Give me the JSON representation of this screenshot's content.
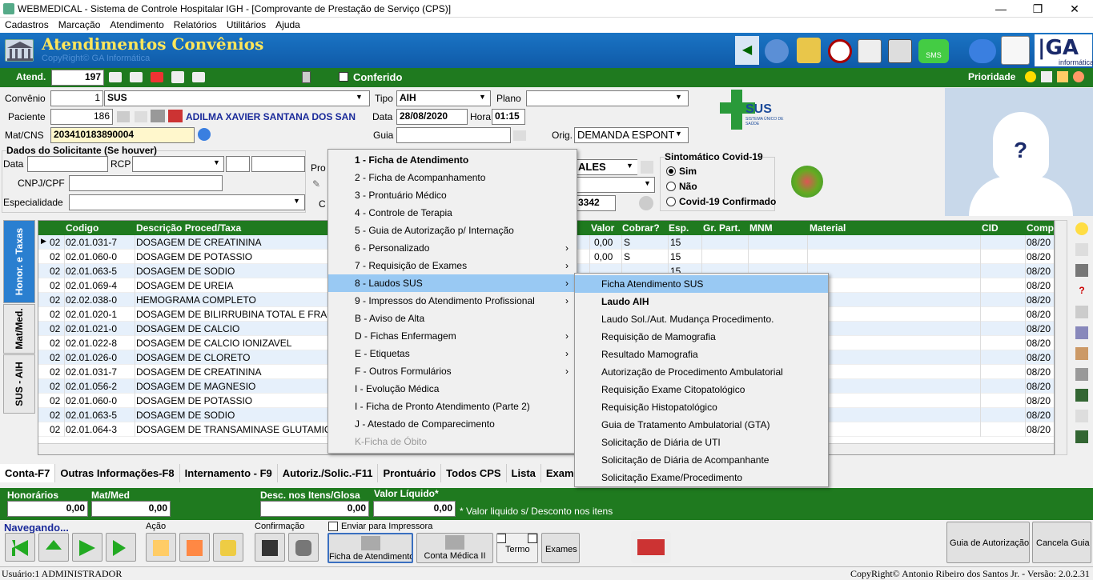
{
  "window": {
    "title": "WEBMEDICAL - Sistema de Controle Hospitalar IGH - [Comprovante de Prestação de Serviço  (CPS)]",
    "minimize": "—",
    "restore": "❐",
    "close": "✕"
  },
  "menubar": [
    "Cadastros",
    "Marcação",
    "Atendimento",
    "Relatórios",
    "Utilitários",
    "Ajuda"
  ],
  "banner": {
    "title": "Atendimentos Convênios",
    "subtitle": "CopyRight© GA Informática",
    "brand": "informática"
  },
  "topbar": {
    "atend_label": "Atend.",
    "atend_value": "197",
    "conferido": "Conferido",
    "prioridade": "Prioridade"
  },
  "form": {
    "convenio_label": "Convênio",
    "convenio_code": "1",
    "convenio_name": "SUS",
    "tipo_label": "Tipo",
    "tipo_value": "AIH",
    "plano_label": "Plano",
    "plano_value": "",
    "paciente_label": "Paciente",
    "paciente_code": "186",
    "paciente_name": "ADILMA XAVIER SANTANA DOS SAN",
    "data_label": "Data",
    "data_value": "28/08/2020",
    "hora_label": "Hora",
    "hora_value": "01:15",
    "matcns_label": "Mat/CNS",
    "matcns_value": "203410183890004",
    "guia_label": "Guia",
    "guia_value": "",
    "orig_label": "Orig.",
    "orig_value": "DEMANDA ESPONT",
    "solicitante_header": "Dados do Solicitante (Se houver)",
    "data2_label": "Data",
    "rcp_label": "RCP",
    "cnpj_label": "CNPJ/CPF",
    "especialidade_label": "Especialidade",
    "pro_label": "Pro",
    "c_label": "C",
    "partial1": "ALES",
    "partial2": "3342"
  },
  "covid": {
    "title": "Sintomático Covid-19",
    "options": [
      "Sim",
      "Não",
      "Covid-19 Confirmado"
    ],
    "selected": "Sim"
  },
  "sus_logo": {
    "text": "SUS",
    "sub": "SISTEMA ÚNICO DE SAÚDE"
  },
  "vtabs": [
    "Honor. e Taxas",
    "Mat/Med.",
    "SUS - AIH"
  ],
  "grid": {
    "headers": {
      "codigo": "Codigo",
      "descricao": "Descrição Proced/Taxa",
      "valor": "Valor",
      "cobrar": "Cobrar?",
      "esp": "Esp.",
      "grpart": "Gr. Part.",
      "mnm": "MNM",
      "material": "Material",
      "cid": "CID",
      "comp": "Comp"
    },
    "rows": [
      {
        "g": "02",
        "cod": "02.01.031-7",
        "desc": "DOSAGEM DE CREATININA",
        "valor": "0,00",
        "cob": "S",
        "esp": "15",
        "comp": "08/20"
      },
      {
        "g": "02",
        "cod": "02.01.060-0",
        "desc": "DOSAGEM DE POTASSIO",
        "valor": "0,00",
        "cob": "S",
        "esp": "15",
        "comp": "08/20"
      },
      {
        "g": "02",
        "cod": "02.01.063-5",
        "desc": "DOSAGEM DE SODIO",
        "valor": "",
        "cob": "",
        "esp": "15",
        "comp": "08/20"
      },
      {
        "g": "02",
        "cod": "02.01.069-4",
        "desc": "DOSAGEM DE UREIA",
        "valor": "",
        "cob": "",
        "esp": "",
        "comp": "08/20"
      },
      {
        "g": "02",
        "cod": "02.02.038-0",
        "desc": "HEMOGRAMA COMPLETO",
        "valor": "",
        "cob": "",
        "esp": "",
        "comp": "08/20"
      },
      {
        "g": "02",
        "cod": "02.01.020-1",
        "desc": "DOSAGEM DE BILIRRUBINA TOTAL E FRAC",
        "valor": "",
        "cob": "",
        "esp": "",
        "comp": "08/20"
      },
      {
        "g": "02",
        "cod": "02.01.021-0",
        "desc": "DOSAGEM DE CALCIO",
        "valor": "",
        "cob": "",
        "esp": "",
        "comp": "08/20"
      },
      {
        "g": "02",
        "cod": "02.01.022-8",
        "desc": "DOSAGEM DE CALCIO IONIZAVEL",
        "valor": "",
        "cob": "",
        "esp": "",
        "comp": "08/20"
      },
      {
        "g": "02",
        "cod": "02.01.026-0",
        "desc": "DOSAGEM DE CLORETO",
        "valor": "",
        "cob": "",
        "esp": "",
        "comp": "08/20"
      },
      {
        "g": "02",
        "cod": "02.01.031-7",
        "desc": "DOSAGEM DE CREATININA",
        "valor": "",
        "cob": "",
        "esp": "",
        "comp": "08/20"
      },
      {
        "g": "02",
        "cod": "02.01.056-2",
        "desc": "DOSAGEM DE MAGNESIO",
        "valor": "",
        "cob": "",
        "esp": "",
        "comp": "08/20"
      },
      {
        "g": "02",
        "cod": "02.01.060-0",
        "desc": "DOSAGEM DE POTASSIO",
        "valor": "",
        "cob": "",
        "esp": "",
        "comp": "08/20"
      },
      {
        "g": "02",
        "cod": "02.01.063-5",
        "desc": "DOSAGEM DE SODIO",
        "valor": "",
        "cob": "",
        "esp": "",
        "comp": "08/20"
      },
      {
        "g": "02",
        "cod": "02.01.064-3",
        "desc": "DOSAGEM DE TRANSAMINASE GLUTAMIC",
        "valor": "",
        "cob": "",
        "esp": "",
        "comp": "08/20"
      }
    ]
  },
  "bottom_tabs": [
    "Conta-F7",
    "Outras Informações-F8",
    "Internamento - F9",
    "Autoriz./Solic.-F11",
    "Prontuário",
    "Todos CPS",
    "Lista",
    "Exam"
  ],
  "totals": {
    "honorarios_label": "Honorários",
    "honorarios": "0,00",
    "matmed_label": "Mat/Med",
    "matmed": "0,00",
    "desc_label": "Desc. nos Itens/Glosa",
    "desc": "0,00",
    "liquido_label": "Valor Líquido*",
    "liquido": "0,00",
    "note": "* Valor liquido s/ Desconto nos itens"
  },
  "nav": {
    "navegando": "Navegando...",
    "acao": "Ação",
    "confirmacao": "Confirmação",
    "enviar": "Enviar para Impressora",
    "ficha": "Ficha de Atendimento",
    "conta": "Conta Médica II",
    "termo": "Termo",
    "exames": "Exames",
    "guia": "Guia de Autorização",
    "cancela": "Cancela Guia"
  },
  "status": {
    "left": "Usuário:1 ADMINISTRADOR",
    "right": "CopyRight© Antonio Ribeiro dos Santos Jr. - Versão: 2.0.2.31"
  },
  "context_menu": [
    {
      "label": "1 - Ficha de Atendimento",
      "bold": true
    },
    {
      "label": "2 - Ficha de Acompanhamento"
    },
    {
      "label": "3 - Prontuário Médico"
    },
    {
      "label": "4 - Controle de Terapia"
    },
    {
      "label": "5 - Guia de Autorização p/ Internação"
    },
    {
      "label": "6 - Personalizado",
      "sub": true
    },
    {
      "label": "7 - Requisição de Exames",
      "sub": true
    },
    {
      "label": "8 - Laudos SUS",
      "sub": true,
      "selected": true
    },
    {
      "label": "9 - Impressos do Atendimento Profissional",
      "sub": true
    },
    {
      "label": "B - Aviso de Alta"
    },
    {
      "label": "D - Fichas Enfermagem",
      "sub": true
    },
    {
      "label": "E - Etiquetas",
      "sub": true
    },
    {
      "label": "F - Outros Formulários",
      "sub": true
    },
    {
      "label": "I - Evolução Médica"
    },
    {
      "label": "I - Ficha de Pronto Atendimento (Parte 2)"
    },
    {
      "label": "J - Atestado de Comparecimento"
    },
    {
      "label": "K-Ficha de Óbito",
      "disabled": true
    }
  ],
  "submenu": [
    {
      "label": "Ficha Atendimento SUS",
      "selected": true
    },
    {
      "label": "Laudo AIH",
      "bold": true
    },
    {
      "label": "Laudo Sol./Aut. Mudança Procedimento."
    },
    {
      "label": "Requisição de Mamografia"
    },
    {
      "label": "Resultado Mamografia"
    },
    {
      "label": "Autorização de Procedimento Ambulatorial"
    },
    {
      "label": "Requisição Exame Citopatológico"
    },
    {
      "label": "Requisição Histopatológico"
    },
    {
      "label": "Guia de Tratamento Ambulatorial (GTA)"
    },
    {
      "label": "Solicitação de Diária de UTI"
    },
    {
      "label": "Solicitação de Diária de Acompanhante"
    },
    {
      "label": "Solicitação Exame/Procedimento"
    }
  ],
  "colors": {
    "green": "#1f7a1f",
    "blue": "#1a74c4",
    "yellow": "#ffe65a",
    "select": "#99c9f3"
  }
}
